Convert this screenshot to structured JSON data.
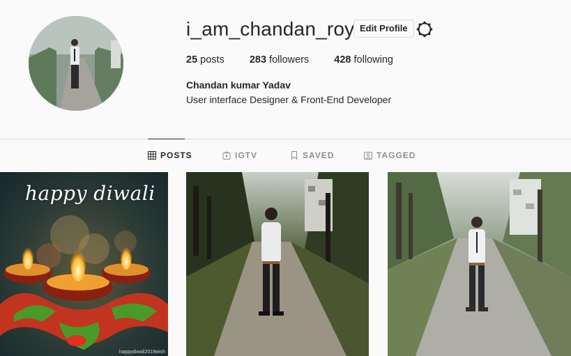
{
  "profile": {
    "username": "i_am_chandan_roy",
    "edit_label": "Edit Profile",
    "stats": [
      {
        "count": "25",
        "label": "posts"
      },
      {
        "count": "283",
        "label": "followers"
      },
      {
        "count": "428",
        "label": "following"
      }
    ],
    "full_name": "Chandan kumar Yadav",
    "bio": "User interface Designer & Front-End Developer"
  },
  "tabs": [
    {
      "label": "POSTS",
      "icon": "grid-icon",
      "active": true
    },
    {
      "label": "IGTV",
      "icon": "tv-icon",
      "active": false
    },
    {
      "label": "SAVED",
      "icon": "bookmark-icon",
      "active": false
    },
    {
      "label": "TAGGED",
      "icon": "tag-person-icon",
      "active": false
    }
  ],
  "posts": [
    {
      "title_text": "happy diwali",
      "watermark": "happydiwali2019wish"
    },
    {},
    {}
  ],
  "colors": {
    "text": "#262626",
    "muted": "#8e8e8e",
    "border": "#dbdbdb",
    "bg": "#fafafa"
  }
}
